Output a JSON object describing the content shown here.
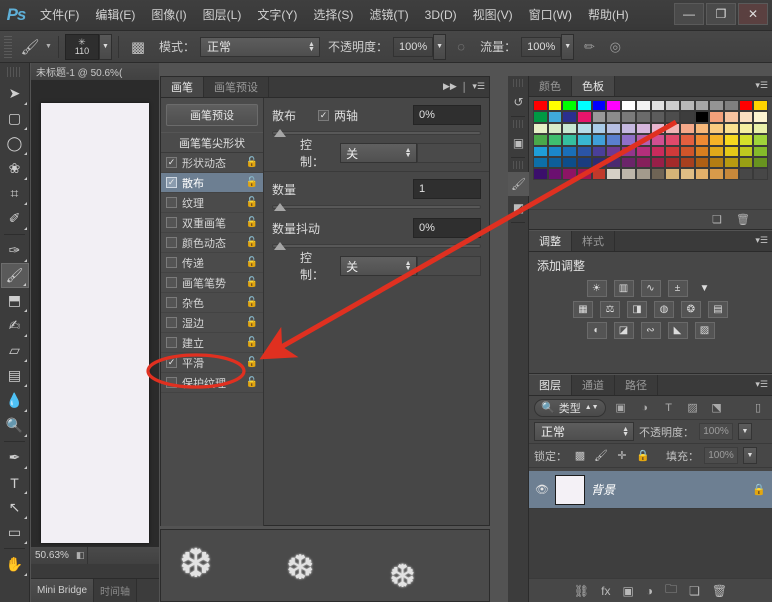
{
  "app": {
    "logo": "Ps",
    "menus": [
      "文件(F)",
      "编辑(E)",
      "图像(I)",
      "图层(L)",
      "文字(Y)",
      "选择(S)",
      "滤镜(T)",
      "3D(D)",
      "视图(V)",
      "窗口(W)",
      "帮助(H)"
    ],
    "window_buttons": {
      "minimize": "—",
      "maximize": "❐",
      "close": "✕"
    }
  },
  "options_bar": {
    "tool_icon": "brush-tool",
    "brush_star": "✳",
    "brush_size": "110",
    "toggle_panel_icon": "brush-panel-toggle",
    "mode_label": "模式：",
    "mode_value": "正常",
    "opacity_label": "不透明度：",
    "opacity_value": "100%",
    "airbrush_icon": "airbrush-icon",
    "flow_label": "流量：",
    "flow_value": "100%",
    "tablet_pressure_size_icon": "pressure-size-icon",
    "tablet_pressure_opacity_icon": "pressure-opacity-icon"
  },
  "toolbar": {
    "tools": [
      {
        "name": "move-tool",
        "glyph": "➤"
      },
      {
        "name": "marquee-tool",
        "glyph": "▢"
      },
      {
        "name": "lasso-tool",
        "glyph": "◯"
      },
      {
        "name": "quick-selection-tool",
        "glyph": "❀"
      },
      {
        "name": "crop-tool",
        "glyph": "⌗"
      },
      {
        "name": "eyedropper-tool",
        "glyph": "✎"
      },
      {
        "name": "healing-brush-tool",
        "glyph": "✂"
      },
      {
        "name": "brush-tool",
        "glyph": "🖌"
      },
      {
        "name": "clone-stamp-tool",
        "glyph": "⬒"
      },
      {
        "name": "history-brush-tool",
        "glyph": "✍"
      },
      {
        "name": "eraser-tool",
        "glyph": "▱"
      },
      {
        "name": "gradient-tool",
        "glyph": "▤"
      },
      {
        "name": "blur-tool",
        "glyph": "💧"
      },
      {
        "name": "dodge-tool",
        "glyph": "🔍"
      },
      {
        "name": "pen-tool",
        "glyph": "✒"
      },
      {
        "name": "type-tool",
        "glyph": "T"
      },
      {
        "name": "path-selection-tool",
        "glyph": "↖"
      },
      {
        "name": "rectangle-tool",
        "glyph": "▭"
      },
      {
        "name": "hand-tool",
        "glyph": "✋"
      }
    ]
  },
  "document": {
    "tab_title": "未标题-1 @ 50.6%(",
    "zoom": "50.63%",
    "bottom_tabs": [
      {
        "label": "Mini Bridge",
        "active": true
      },
      {
        "label": "时间轴",
        "active": false
      }
    ]
  },
  "brush_panel": {
    "tabs": [
      {
        "label": "画笔",
        "active": true
      },
      {
        "label": "画笔预设",
        "active": false
      }
    ],
    "collapse_icon": "collapse-icon",
    "menu_icon": "panel-menu-icon",
    "preset_button": "画笔预设",
    "tip_shape_header": "画笔笔尖形状",
    "items": [
      {
        "label": "形状动态",
        "checked": true,
        "selected": false
      },
      {
        "label": "散布",
        "checked": true,
        "selected": true
      },
      {
        "label": "纹理",
        "checked": false,
        "selected": false
      },
      {
        "label": "双重画笔",
        "checked": false,
        "selected": false
      },
      {
        "label": "颜色动态",
        "checked": false,
        "selected": false
      },
      {
        "label": "传递",
        "checked": false,
        "selected": false
      },
      {
        "label": "画笔笔势",
        "checked": false,
        "selected": false
      },
      {
        "label": "杂色",
        "checked": false,
        "selected": false
      },
      {
        "label": "湿边",
        "checked": false,
        "selected": false
      },
      {
        "label": "建立",
        "checked": false,
        "selected": false
      },
      {
        "label": "平滑",
        "checked": true,
        "selected": false
      },
      {
        "label": "保护纹理",
        "checked": false,
        "selected": false
      }
    ],
    "options": {
      "scatter_label": "散布",
      "both_axes_label": "两轴",
      "both_axes_checked": true,
      "scatter_value": "0%",
      "control1_label": "控制：",
      "control1_value": "关",
      "count_label": "数量",
      "count_value": "1",
      "count_jitter_label": "数量抖动",
      "count_jitter_value": "0%",
      "control2_label": "控制：",
      "control2_value": "关"
    }
  },
  "brush_preview": {
    "stroke_icon": "snowflake-stroke-preview",
    "flakes": [
      "❆",
      "❆",
      "❆"
    ]
  },
  "rail": {
    "icons": [
      {
        "name": "history-icon",
        "glyph": "↺"
      },
      {
        "name": "color-swatch-icon",
        "glyph": "▣"
      },
      {
        "name": "brush-rail-icon",
        "glyph": "🖌",
        "active": true
      },
      {
        "name": "clone-source-icon",
        "glyph": "◩"
      }
    ]
  },
  "swatch_panel": {
    "tabs": [
      {
        "label": "颜色",
        "active": false
      },
      {
        "label": "色板",
        "active": true
      }
    ],
    "menu_icon": "panel-menu-icon",
    "new_swatch_icon": "new-swatch-icon",
    "delete_swatch_icon": "trash-icon",
    "colors": [
      "#ff0000",
      "#ffff00",
      "#00ff00",
      "#00ffff",
      "#0000ff",
      "#ff00ff",
      "#ffffff",
      "#f2f2f2",
      "#e0e0e0",
      "#cccccc",
      "#b8b8b8",
      "#a6a6a6",
      "#949494",
      "#7f7f7f",
      "#ff0000",
      "#ffd400",
      "#009944",
      "#3faadc",
      "#2b2f8f",
      "#e8156b",
      "#999999",
      "#8c8c8c",
      "#7a7a7a",
      "#6b6b6b",
      "#5c5c5c",
      "#4d4d4d",
      "#3d3d3d",
      "#000000",
      "#f4a07a",
      "#f7c3a0",
      "#fbe0c0",
      "#fdf4d0",
      "#e6f0c8",
      "#d7ecc8",
      "#c7e7d2",
      "#b6dde8",
      "#a9cbe8",
      "#b6bfe2",
      "#c5b8e0",
      "#d6b6dd",
      "#e8b5cf",
      "#f0b5b5",
      "#f5a98a",
      "#f7b87a",
      "#f9cb80",
      "#fbe08f",
      "#f5efa0",
      "#e9f0a8",
      "#4aa84a",
      "#3fbf6f",
      "#35c0a0",
      "#39b7d2",
      "#3f9fd9",
      "#5a7fcf",
      "#8f6fc8",
      "#b45fb0",
      "#d14f91",
      "#e0496b",
      "#e45f3f",
      "#ee8a33",
      "#f5b327",
      "#f7d91f",
      "#d4e02a",
      "#9fd43a",
      "#1f9ed8",
      "#1b87c9",
      "#1a6fb8",
      "#2b54a5",
      "#4a3f99",
      "#6f3a93",
      "#93358c",
      "#b42f7b",
      "#c92b5c",
      "#cf3a3a",
      "#d0552a",
      "#d97f1f",
      "#dfa91a",
      "#e4c918",
      "#bfc81f",
      "#84bb2a",
      "#0d6fa8",
      "#0d5e99",
      "#0d4d8a",
      "#1a3c7f",
      "#2d2d73",
      "#4a2a70",
      "#6b2569",
      "#86205b",
      "#981f48",
      "#a32a2a",
      "#a8401f",
      "#ae5f14",
      "#b47d12",
      "#b89a10",
      "#98a014",
      "#68931f",
      "#3b0f6b",
      "#6b1070",
      "#8d1464",
      "#a01450",
      "#c0392b",
      "#d6d0c6",
      "#bdb6aa",
      "#a39a8c",
      "#6f6455",
      "#d6b477",
      "#e0bd84",
      "#e2b06a",
      "#d89a4a",
      "#c8883a",
      "#474747",
      "#474747"
    ]
  },
  "adjustments_panel": {
    "tabs": [
      {
        "label": "调整",
        "active": true
      },
      {
        "label": "样式",
        "active": false
      }
    ],
    "menu_icon": "panel-menu-icon",
    "title": "添加调整",
    "row1": [
      {
        "name": "brightness-contrast-icon",
        "glyph": "☀"
      },
      {
        "name": "levels-icon",
        "glyph": "▥"
      },
      {
        "name": "curves-icon",
        "glyph": "∿"
      },
      {
        "name": "exposure-icon",
        "glyph": "±"
      },
      {
        "name": "vibrance-icon",
        "glyph": "▽"
      }
    ],
    "row2": [
      {
        "name": "hue-saturation-icon",
        "glyph": "▦"
      },
      {
        "name": "color-balance-icon",
        "glyph": "⚖"
      },
      {
        "name": "black-white-icon",
        "glyph": "◨"
      },
      {
        "name": "photo-filter-icon",
        "glyph": "◍"
      },
      {
        "name": "channel-mixer-icon",
        "glyph": "❂"
      },
      {
        "name": "color-lookup-icon",
        "glyph": "▤"
      }
    ],
    "row3": [
      {
        "name": "invert-icon",
        "glyph": "◐"
      },
      {
        "name": "posterize-icon",
        "glyph": "◪"
      },
      {
        "name": "threshold-icon",
        "glyph": "∾"
      },
      {
        "name": "gradient-map-icon",
        "glyph": "◣"
      },
      {
        "name": "selective-color-icon",
        "glyph": "▨"
      }
    ]
  },
  "layers_panel": {
    "tabs": [
      {
        "label": "图层",
        "active": true
      },
      {
        "label": "通道",
        "active": false
      },
      {
        "label": "路径",
        "active": false
      }
    ],
    "menu_icon": "panel-menu-icon",
    "filter": {
      "search_icon": "search-icon",
      "kind_label": "类型",
      "icons": [
        {
          "name": "filter-pixel-icon",
          "glyph": "▣"
        },
        {
          "name": "filter-adjustment-icon",
          "glyph": "◑"
        },
        {
          "name": "filter-type-icon",
          "glyph": "T"
        },
        {
          "name": "filter-shape-icon",
          "glyph": "▨"
        },
        {
          "name": "filter-smart-object-icon",
          "glyph": "⬔"
        }
      ],
      "toggle_icon": "filter-toggle-icon"
    },
    "blend_mode": "正常",
    "opacity_label": "不透明度：",
    "opacity_value": "100%",
    "lock_label": "锁定：",
    "lock_icons": [
      {
        "name": "lock-transparent-icon",
        "glyph": "▩"
      },
      {
        "name": "lock-image-icon",
        "glyph": "🖌"
      },
      {
        "name": "lock-position-icon",
        "glyph": "✛"
      },
      {
        "name": "lock-all-icon",
        "glyph": "🔒"
      }
    ],
    "fill_label": "填充：",
    "fill_value": "100%",
    "layers": [
      {
        "visible": true,
        "name": "背景",
        "locked": true
      }
    ],
    "footer_icons": [
      {
        "name": "link-layers-icon",
        "glyph": "⛓"
      },
      {
        "name": "layer-style-icon",
        "glyph": "fx"
      },
      {
        "name": "layer-mask-icon",
        "glyph": "▣"
      },
      {
        "name": "adjustment-layer-icon",
        "glyph": "◑"
      },
      {
        "name": "new-group-icon",
        "glyph": "🗀"
      },
      {
        "name": "new-layer-icon",
        "glyph": "❏"
      },
      {
        "name": "delete-layer-icon",
        "glyph": "🗑"
      }
    ]
  },
  "annotation": {
    "arrow_color": "#e03020",
    "ellipse_color": "#e03020",
    "arrow_label": "red-arrow-annotation",
    "ellipse_label": "red-ellipse-annotation"
  }
}
